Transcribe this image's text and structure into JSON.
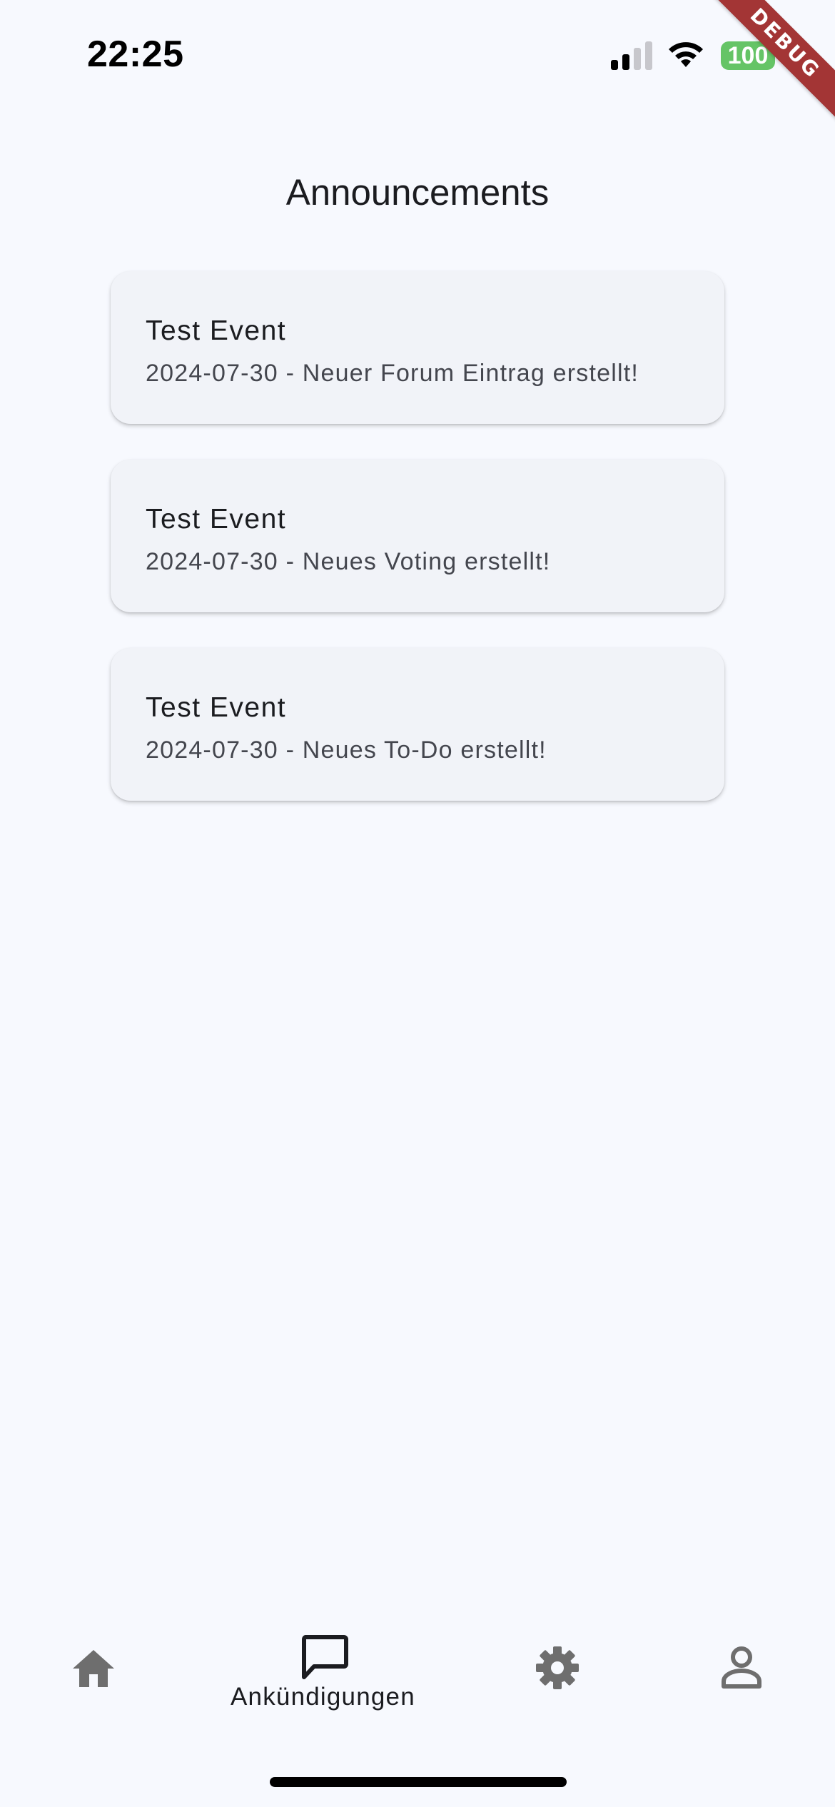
{
  "status_bar": {
    "time": "22:25",
    "battery_level": "100",
    "signal_icon": "cellular-signal-icon",
    "wifi_icon": "wifi-icon",
    "battery_color": "#65c466"
  },
  "debug_banner": "DEBUG",
  "header": {
    "title": "Announcements"
  },
  "announcements": [
    {
      "title": "Test Event",
      "subtitle": "2024-07-30 - Neuer Forum Eintrag erstellt!"
    },
    {
      "title": "Test Event",
      "subtitle": "2024-07-30 - Neues Voting erstellt!"
    },
    {
      "title": "Test Event",
      "subtitle": "2024-07-30 - Neues To-Do erstellt!"
    }
  ],
  "bottom_nav": {
    "items": [
      {
        "icon": "home-icon",
        "label": "",
        "selected": false
      },
      {
        "icon": "chat-bubble-icon",
        "label": "Ankündigungen",
        "selected": true
      },
      {
        "icon": "gear-icon",
        "label": "",
        "selected": false
      },
      {
        "icon": "person-icon",
        "label": "",
        "selected": false
      }
    ]
  },
  "colors": {
    "background": "#f7f9fe",
    "card": "#f1f3f8",
    "inactive_icon": "#6e6e6e",
    "active_icon": "#1b1c20",
    "debug_ribbon": "#a33535"
  }
}
